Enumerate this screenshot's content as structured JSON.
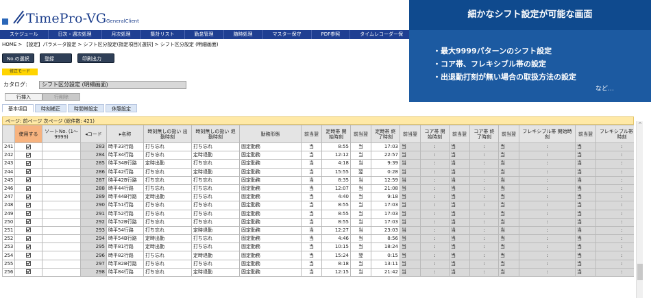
{
  "app": {
    "logo_main": "TimePro-VG",
    "logo_sub": "GeneralClient"
  },
  "nav": [
    "スケジュール",
    "日次・週次処理",
    "月次処理",
    "集計リスト",
    "勤怠管理",
    "随時処理",
    "マスター保守",
    "PDF参照",
    "タイムレコーダー保"
  ],
  "breadcrumb": "HOME > 【設定】パラメータ設定 > シフト区分設定(指定項目)[選択] > シフト区分設定 (明細画面)",
  "toolbar": {
    "btn_select": "No.の選択",
    "btn_register": "登録",
    "btn_print": "印刷出力"
  },
  "mode_badge": "修正モード",
  "catalog": {
    "label": "カタログ:",
    "value": "シフト区分設定 (明細画面)"
  },
  "row_buttons": {
    "insert": "行挿入",
    "delete": "行削除"
  },
  "tabs": [
    "基本項目",
    "時刻補正",
    "時間帯設定",
    "休憩設定"
  ],
  "pager": "ページ: 前ページ 次ページ (総件数: 421)",
  "table": {
    "headers": [
      "",
      "使用する",
      "ソートNo. (1～9999)",
      "◂コード",
      "▸名称",
      "時刻無しの扱い 出勤時刻",
      "時刻無しの扱い 退勤時刻",
      "勤務形態",
      "前当翌",
      "定時帯 開始時刻",
      "前当翌",
      "定時帯 終了時刻",
      "前当翌",
      "コア帯 開始時刻",
      "前当翌",
      "コア帯 終了時刻",
      "前当翌",
      "フレキシブル帯 開始時刻",
      "前当翌",
      "フレキシブル帯 終了時刻"
    ],
    "rows": [
      [
        "241",
        "",
        "283",
        "時平33行路",
        "打ち忘れ",
        "打ち忘れ",
        "固定勤務",
        "当",
        "8:55",
        "当",
        "17:03",
        "当",
        ":",
        "当",
        ":",
        "当",
        ":",
        "当",
        ":"
      ],
      [
        "242",
        "",
        "284",
        "時平34行路",
        "打ち忘れ",
        "定時退勤",
        "固定勤務",
        "当",
        "12:12",
        "当",
        "22:57",
        "当",
        ":",
        "当",
        ":",
        "当",
        ":",
        "当",
        ":"
      ],
      [
        "243",
        "",
        "285",
        "時平34B行路",
        "定時出勤",
        "打ち忘れ",
        "固定勤務",
        "当",
        "4:18",
        "当",
        "9:39",
        "当",
        ":",
        "当",
        ":",
        "当",
        ":",
        "当",
        ":"
      ],
      [
        "244",
        "",
        "286",
        "時平42行路",
        "打ち忘れ",
        "定時退勤",
        "固定勤務",
        "当",
        "15:55",
        "翌",
        "0:28",
        "当",
        ":",
        "当",
        ":",
        "当",
        ":",
        "当",
        ":"
      ],
      [
        "245",
        "",
        "287",
        "時平42B行路",
        "打ち忘れ",
        "打ち忘れ",
        "固定勤務",
        "当",
        "8:35",
        "当",
        "12:59",
        "当",
        ":",
        "当",
        ":",
        "当",
        ":",
        "当",
        ":"
      ],
      [
        "246",
        "",
        "288",
        "時平44行路",
        "打ち忘れ",
        "打ち忘れ",
        "固定勤務",
        "当",
        "12:07",
        "当",
        "21:08",
        "当",
        ":",
        "当",
        ":",
        "当",
        ":",
        "当",
        ":"
      ],
      [
        "247",
        "",
        "289",
        "時平44B行路",
        "定時出勤",
        "打ち忘れ",
        "固定勤務",
        "当",
        "4:40",
        "当",
        "9:18",
        "当",
        ":",
        "当",
        ":",
        "当",
        ":",
        "当",
        ":"
      ],
      [
        "248",
        "",
        "290",
        "時平51行路",
        "打ち忘れ",
        "打ち忘れ",
        "固定勤務",
        "当",
        "8:55",
        "当",
        "17:03",
        "当",
        ":",
        "当",
        ":",
        "当",
        ":",
        "当",
        ":"
      ],
      [
        "249",
        "",
        "291",
        "時平52行路",
        "打ち忘れ",
        "打ち忘れ",
        "固定勤務",
        "当",
        "8:55",
        "当",
        "17:03",
        "当",
        ":",
        "当",
        ":",
        "当",
        ":",
        "当",
        ":"
      ],
      [
        "250",
        "",
        "292",
        "時平52B行路",
        "打ち忘れ",
        "打ち忘れ",
        "固定勤務",
        "当",
        "8:55",
        "当",
        "17:03",
        "当",
        ":",
        "当",
        ":",
        "当",
        ":",
        "当",
        ":"
      ],
      [
        "251",
        "",
        "293",
        "時平54行路",
        "打ち忘れ",
        "定時退勤",
        "固定勤務",
        "当",
        "12:27",
        "当",
        "23:03",
        "当",
        ":",
        "当",
        ":",
        "当",
        ":",
        "当",
        ":"
      ],
      [
        "252",
        "",
        "294",
        "時平54B行路",
        "定時出勤",
        "打ち忘れ",
        "固定勤務",
        "当",
        "4:46",
        "当",
        "8:56",
        "当",
        ":",
        "当",
        ":",
        "当",
        ":",
        "当",
        ":"
      ],
      [
        "253",
        "",
        "295",
        "時平81行路",
        "定時出勤",
        "打ち忘れ",
        "固定勤務",
        "当",
        "10:15",
        "当",
        "18:24",
        "当",
        ":",
        "当",
        ":",
        "当",
        ":",
        "当",
        ":"
      ],
      [
        "254",
        "",
        "296",
        "時平82行路",
        "打ち忘れ",
        "定時退勤",
        "固定勤務",
        "当",
        "15:24",
        "翌",
        "0:15",
        "当",
        ":",
        "当",
        ":",
        "当",
        ":",
        "当",
        ":"
      ],
      [
        "255",
        "",
        "297",
        "時平82B行路",
        "打ち忘れ",
        "打ち忘れ",
        "固定勤務",
        "当",
        "8:18",
        "当",
        "13:11",
        "当",
        ":",
        "当",
        ":",
        "当",
        ":",
        "当",
        ":"
      ],
      [
        "256",
        "",
        "298",
        "時平84行路",
        "打ち忘れ",
        "定時退勤",
        "固定勤務",
        "当",
        "12:15",
        "当",
        "21:42",
        "当",
        ":",
        "当",
        ":",
        "当",
        ":",
        "当",
        ":"
      ]
    ]
  },
  "promo": {
    "title": "細かなシフト設定が可能な画面",
    "items": [
      "・最大9999パターンのシフト設定",
      "・コア帯、フレキシブル帯の設定",
      "・出退勤打刻が無い場合の取扱方法の設定"
    ],
    "more": "など…"
  },
  "colors": {
    "nav": "#1f3f92",
    "promo": "#1c5aa1",
    "highlight_header": "#f7b37f",
    "mode_badge": "#ffd400"
  }
}
